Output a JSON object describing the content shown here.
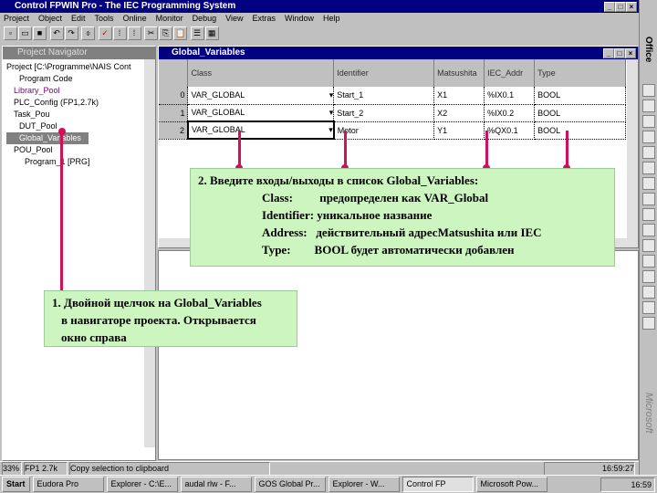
{
  "app": {
    "title": "Control FPWIN Pro - The IEC Programming System"
  },
  "menu": [
    "Project",
    "Object",
    "Edit",
    "Tools",
    "Online",
    "Monitor",
    "Debug",
    "View",
    "Extras",
    "Window",
    "Help"
  ],
  "navigator": {
    "title": "Project Navigator",
    "items": [
      "Project [C:\\Programme\\NAIS Cont",
      "Program Code",
      "Library_Pool",
      "PLC_Config (FP1,2.7k)",
      "Task_Pou",
      "DUT_Pool",
      "Global_Variables",
      "POU_Pool",
      "Program_1 [PRG]"
    ]
  },
  "globals": {
    "title": "Global_Variables",
    "columns": [
      "Class",
      "Identifier",
      "Matsushita",
      "IEC_Addr",
      "Type"
    ],
    "rows": [
      {
        "n": "0",
        "class": "VAR_GLOBAL",
        "id": "Start_1",
        "mat": "X1",
        "iec": "%IX0.1",
        "type": "BOOL"
      },
      {
        "n": "1",
        "class": "VAR_GLOBAL",
        "id": "Start_2",
        "mat": "X2",
        "iec": "%IX0.2",
        "type": "BOOL"
      },
      {
        "n": "2",
        "class": "VAR_GLOBAL",
        "id": "Motor",
        "mat": "Y1",
        "iec": "%QX0.1",
        "type": "BOOL"
      }
    ]
  },
  "callout1": {
    "lines": [
      "1. Двойной щелчок на Global_Variables",
      "в навигаторе проекта. Открывается",
      "окно справа"
    ]
  },
  "callout2": {
    "lines": [
      "2. Введите входы/выходы в список Global_Variables:",
      "Class:         предопределен как VAR_Global",
      "Identifier: уникальное название",
      "Address:   действительный адресMatsushita или IEC",
      "Type:        BOOL будет автоматически добавлен"
    ]
  },
  "status": {
    "zoom": "33%",
    "plc": "FP1 2.7k",
    "message": "Copy selection to clipboard",
    "time": "16:59:27"
  },
  "taskbar": {
    "start": "Start",
    "items": [
      "Eudora Pro",
      "Explorer - C:\\E...",
      "audal rlw - F...",
      "GOS Global Pr...",
      "Explorer - W...",
      "Control FP",
      "Microsoft Pow..."
    ],
    "clock": "16:59"
  },
  "office": {
    "label": "Office",
    "brand": "Microsoft"
  },
  "colors": {
    "accent": "#d0105a",
    "callout": "#ccf5c0",
    "titlebar": "#000080"
  }
}
